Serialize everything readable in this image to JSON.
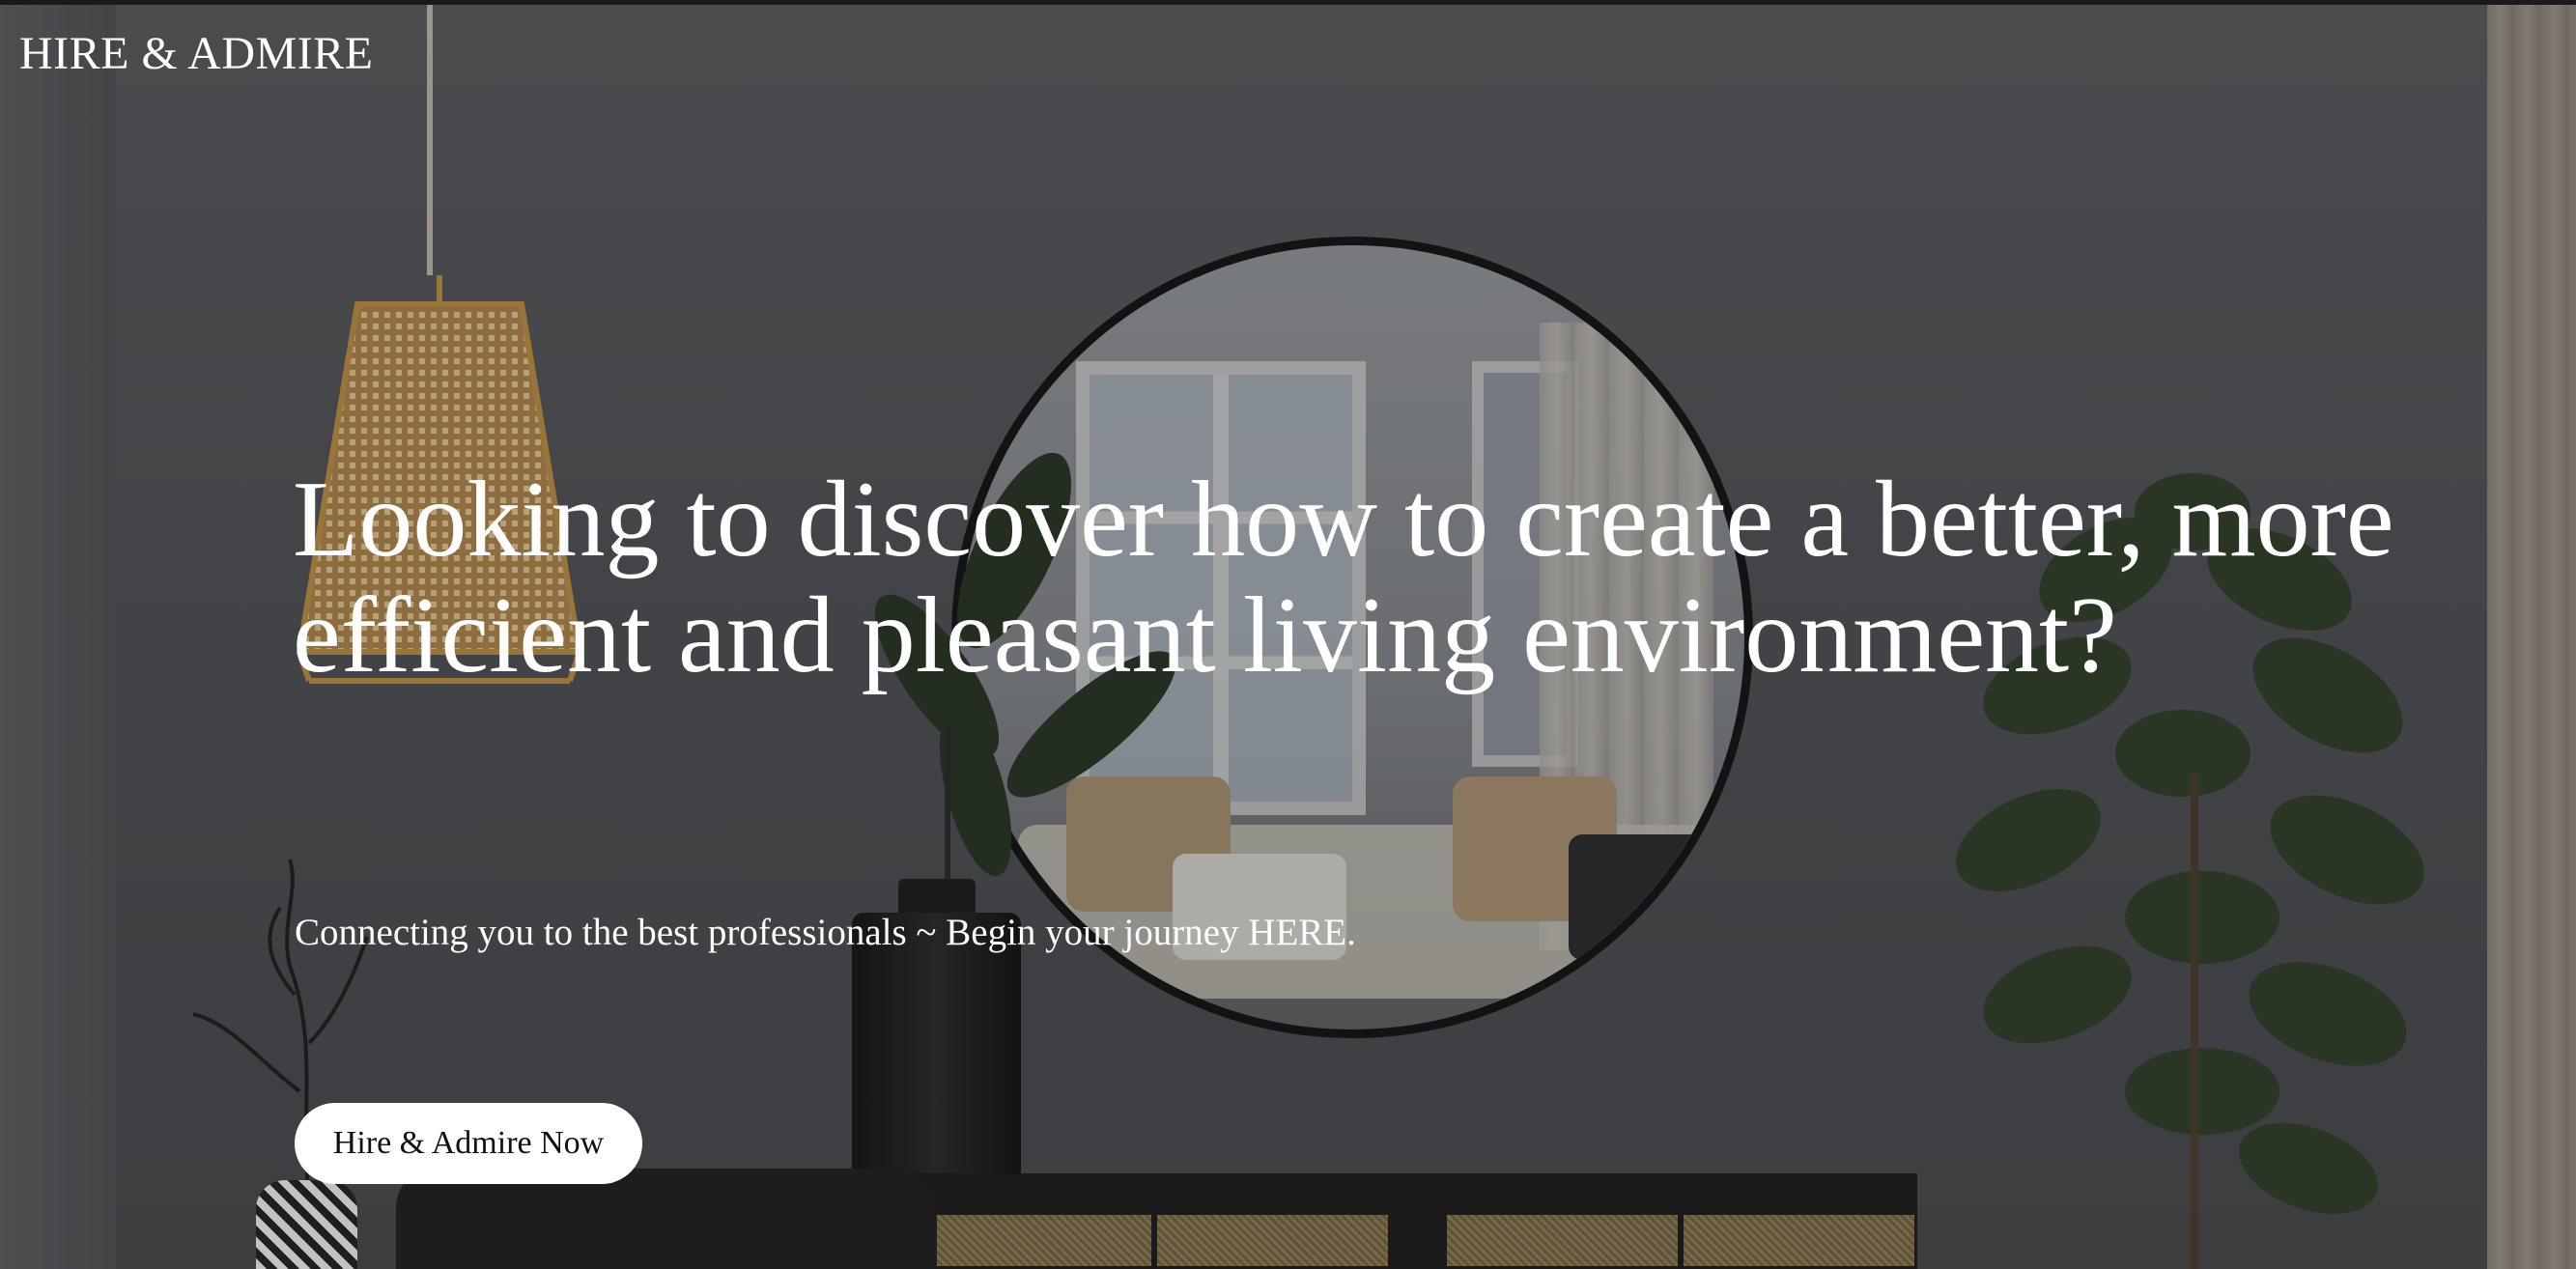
{
  "brand": {
    "logo_text": "HIRE & ADMIRE"
  },
  "hero": {
    "headline": "Looking to discover how to create a better, more efficient and pleasant living environment?",
    "subtext": "Connecting you to the best professionals ~ Begin your journey HERE.",
    "cta_label": "Hire & Admire Now"
  },
  "colors": {
    "text": "#ffffff",
    "button_bg": "#ffffff",
    "button_text": "#111111"
  },
  "background": {
    "image_description_icon": "interior-photo-icon"
  }
}
